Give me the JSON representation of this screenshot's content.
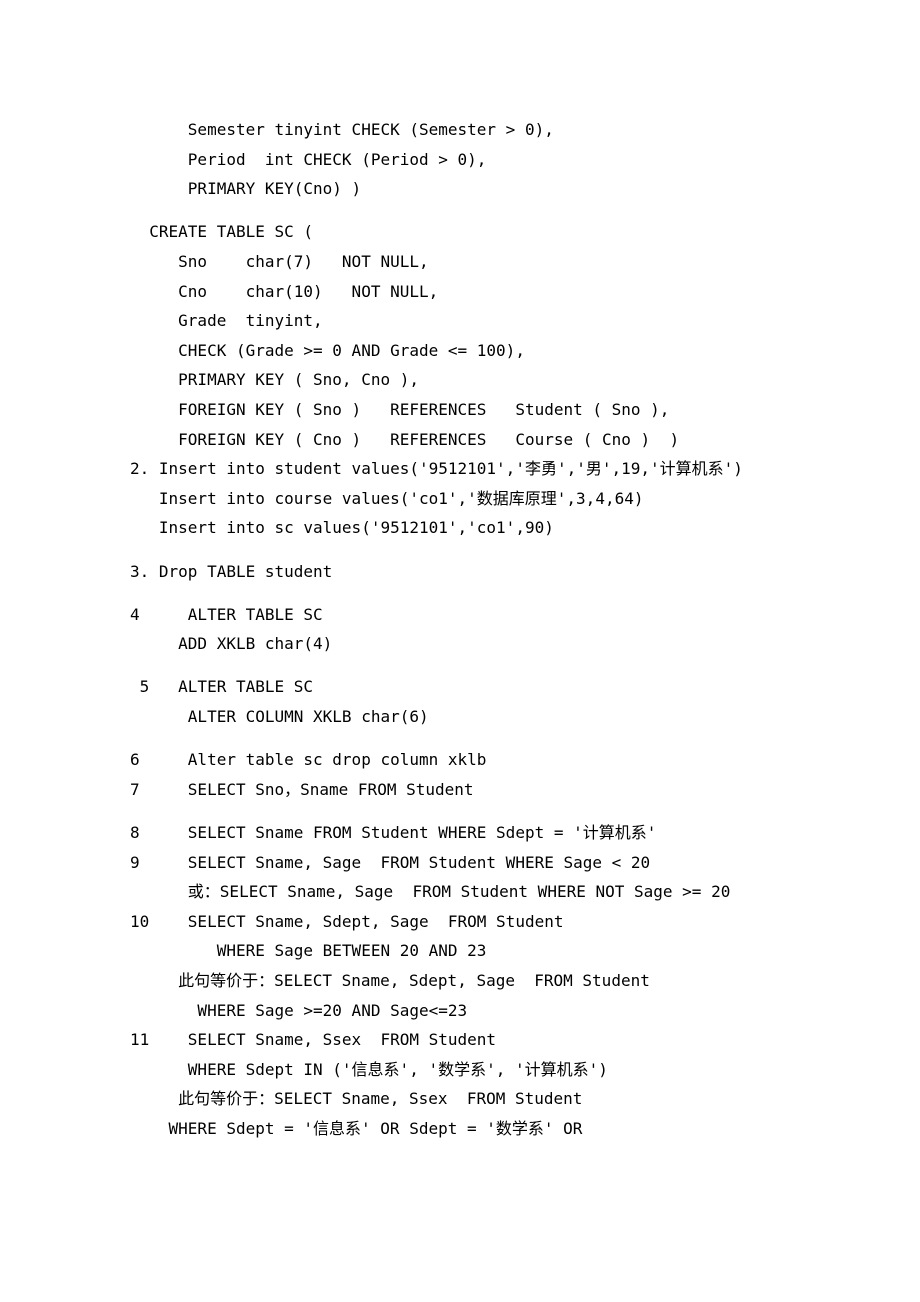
{
  "lines": [
    "      Semester tinyint CHECK (Semester > 0),",
    "      Period  int CHECK (Period > 0),",
    "      PRIMARY KEY(Cno) )",
    "__SP__",
    "  CREATE TABLE SC (",
    "     Sno    char(7)   NOT NULL,",
    "     Cno    char(10)   NOT NULL,",
    "     Grade  tinyint,",
    "     CHECK (Grade >= 0 AND Grade <= 100),",
    "     PRIMARY KEY ( Sno, Cno ),",
    "     FOREIGN KEY ( Sno )   REFERENCES   Student ( Sno ),",
    "     FOREIGN KEY ( Cno )   REFERENCES   Course ( Cno )  )",
    "2. Insert into student values('9512101','李勇','男',19,'计算机系')",
    "   Insert into course values('co1','数据库原理',3,4,64)",
    "   Insert into sc values('9512101','co1',90)",
    "__SP__",
    "3. Drop TABLE student",
    "__SP__",
    "4     ALTER TABLE SC",
    "     ADD XKLB char(4)",
    "__SP__",
    " 5   ALTER TABLE SC",
    "      ALTER COLUMN XKLB char(6)",
    "__SP__",
    "6     Alter table sc drop column xklb",
    "7     SELECT Sno，Sname FROM Student",
    "__SP__",
    "8     SELECT Sname FROM Student WHERE Sdept = '计算机系'",
    "9     SELECT Sname, Sage  FROM Student WHERE Sage < 20",
    "      或：SELECT Sname, Sage  FROM Student WHERE NOT Sage >= 20",
    "10    SELECT Sname, Sdept, Sage  FROM Student",
    "         WHERE Sage BETWEEN 20 AND 23",
    "     此句等价于：SELECT Sname, Sdept, Sage  FROM Student",
    "       WHERE Sage >=20 AND Sage<=23",
    "11    SELECT Sname, Ssex  FROM Student",
    "      WHERE Sdept IN ('信息系', '数学系', '计算机系')",
    "     此句等价于：SELECT Sname, Ssex  FROM Student",
    "    WHERE Sdept = '信息系' OR Sdept = '数学系' OR"
  ]
}
